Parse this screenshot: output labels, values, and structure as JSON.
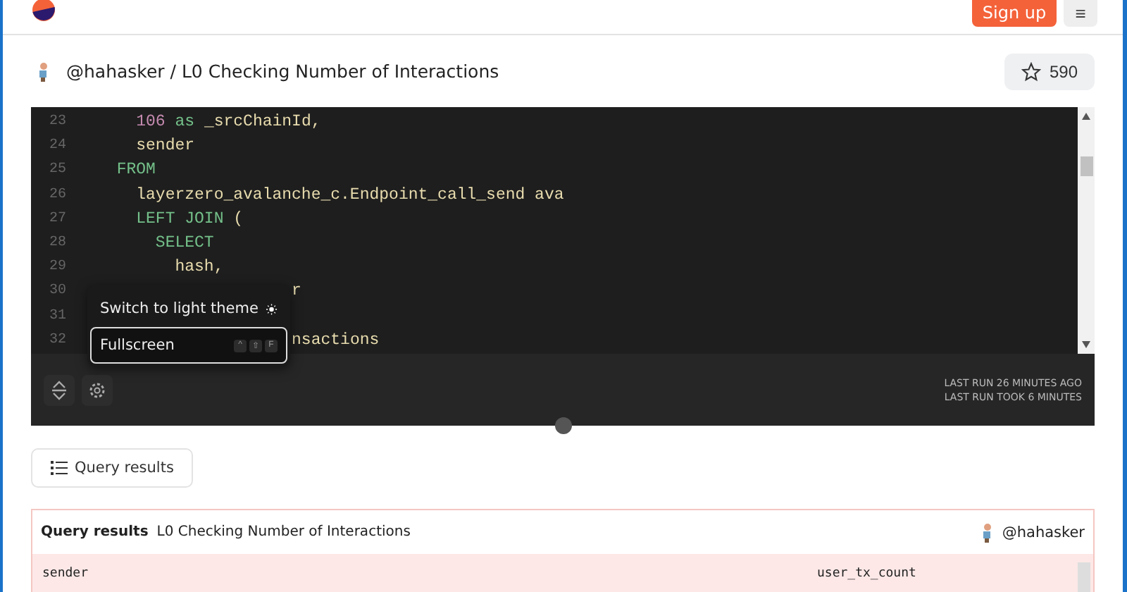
{
  "header": {
    "signup": "Sign up",
    "menu_icon": "≡"
  },
  "title": {
    "user": "@hahasker",
    "separator": "/",
    "name": "L0 Checking Number of Interactions",
    "stars": "590"
  },
  "editor": {
    "lines": [
      {
        "number": "23",
        "tokens": [
          {
            "kind": "number",
            "text": "    106"
          },
          {
            "kind": "keyword",
            "text": " as "
          },
          {
            "kind": "plain",
            "text": "_srcChainId,"
          }
        ]
      },
      {
        "number": "24",
        "tokens": [
          {
            "kind": "plain",
            "text": "    sender"
          }
        ]
      },
      {
        "number": "25",
        "tokens": [
          {
            "kind": "keyword",
            "text": "  FROM"
          }
        ]
      },
      {
        "number": "26",
        "tokens": [
          {
            "kind": "plain",
            "text": "    layerzero_avalanche_c.Endpoint_call_send ava"
          }
        ]
      },
      {
        "number": "27",
        "tokens": [
          {
            "kind": "keyword",
            "text": "    LEFT JOIN "
          },
          {
            "kind": "plain",
            "text": "("
          }
        ]
      },
      {
        "number": "28",
        "tokens": [
          {
            "kind": "keyword",
            "text": "      SELECT"
          }
        ]
      },
      {
        "number": "29",
        "tokens": [
          {
            "kind": "plain",
            "text": "        hash,"
          }
        ]
      },
      {
        "number": "30",
        "tokens": [
          {
            "kind": "plain",
            "text": "                    r"
          }
        ]
      },
      {
        "number": "31"
      },
      {
        "number": "32",
        "tokens": [
          {
            "kind": "plain",
            "text": "                    nsactions"
          }
        ]
      }
    ],
    "last_run": "LAST RUN 26 MINUTES AGO",
    "run_time": "LAST RUN TOOK 6 MINUTES",
    "menu": [
      {
        "kind": "theme",
        "label": "Switch to light theme",
        "selected": false
      },
      {
        "kind": "fullscreen",
        "label": "Fullscreen",
        "selected": true,
        "keys": [
          "^",
          "⇧",
          "F"
        ]
      }
    ]
  },
  "tab": {
    "label": "Query results"
  },
  "results": {
    "title": "Query results",
    "name": "L0 Checking Number of Interactions",
    "owner": "@hahasker",
    "columns": [
      "sender",
      "user_tx_count"
    ]
  }
}
